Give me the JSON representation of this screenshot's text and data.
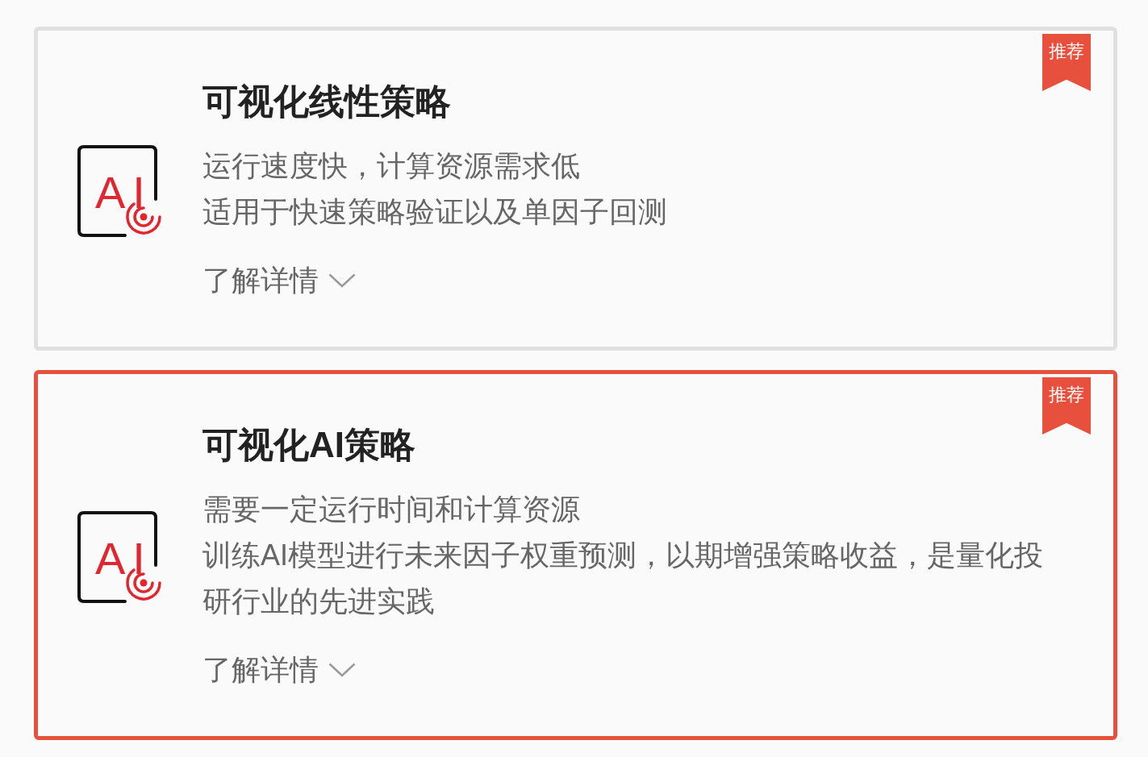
{
  "cards": [
    {
      "title": "可视化线性策略",
      "badge": "推荐",
      "icon_text": "AI",
      "selected": false,
      "descriptions": [
        "运行速度快，计算资源需求低",
        "适用于快速策略验证以及单因子回测"
      ],
      "link": "了解详情"
    },
    {
      "title": "可视化AI策略",
      "badge": "推荐",
      "icon_text": "AI",
      "selected": true,
      "descriptions": [
        "需要一定运行时间和计算资源",
        "训练AI模型进行未来因子权重预测，以期增强策略收益，是量化投研行业的先进实践"
      ],
      "link": "了解详情"
    }
  ]
}
